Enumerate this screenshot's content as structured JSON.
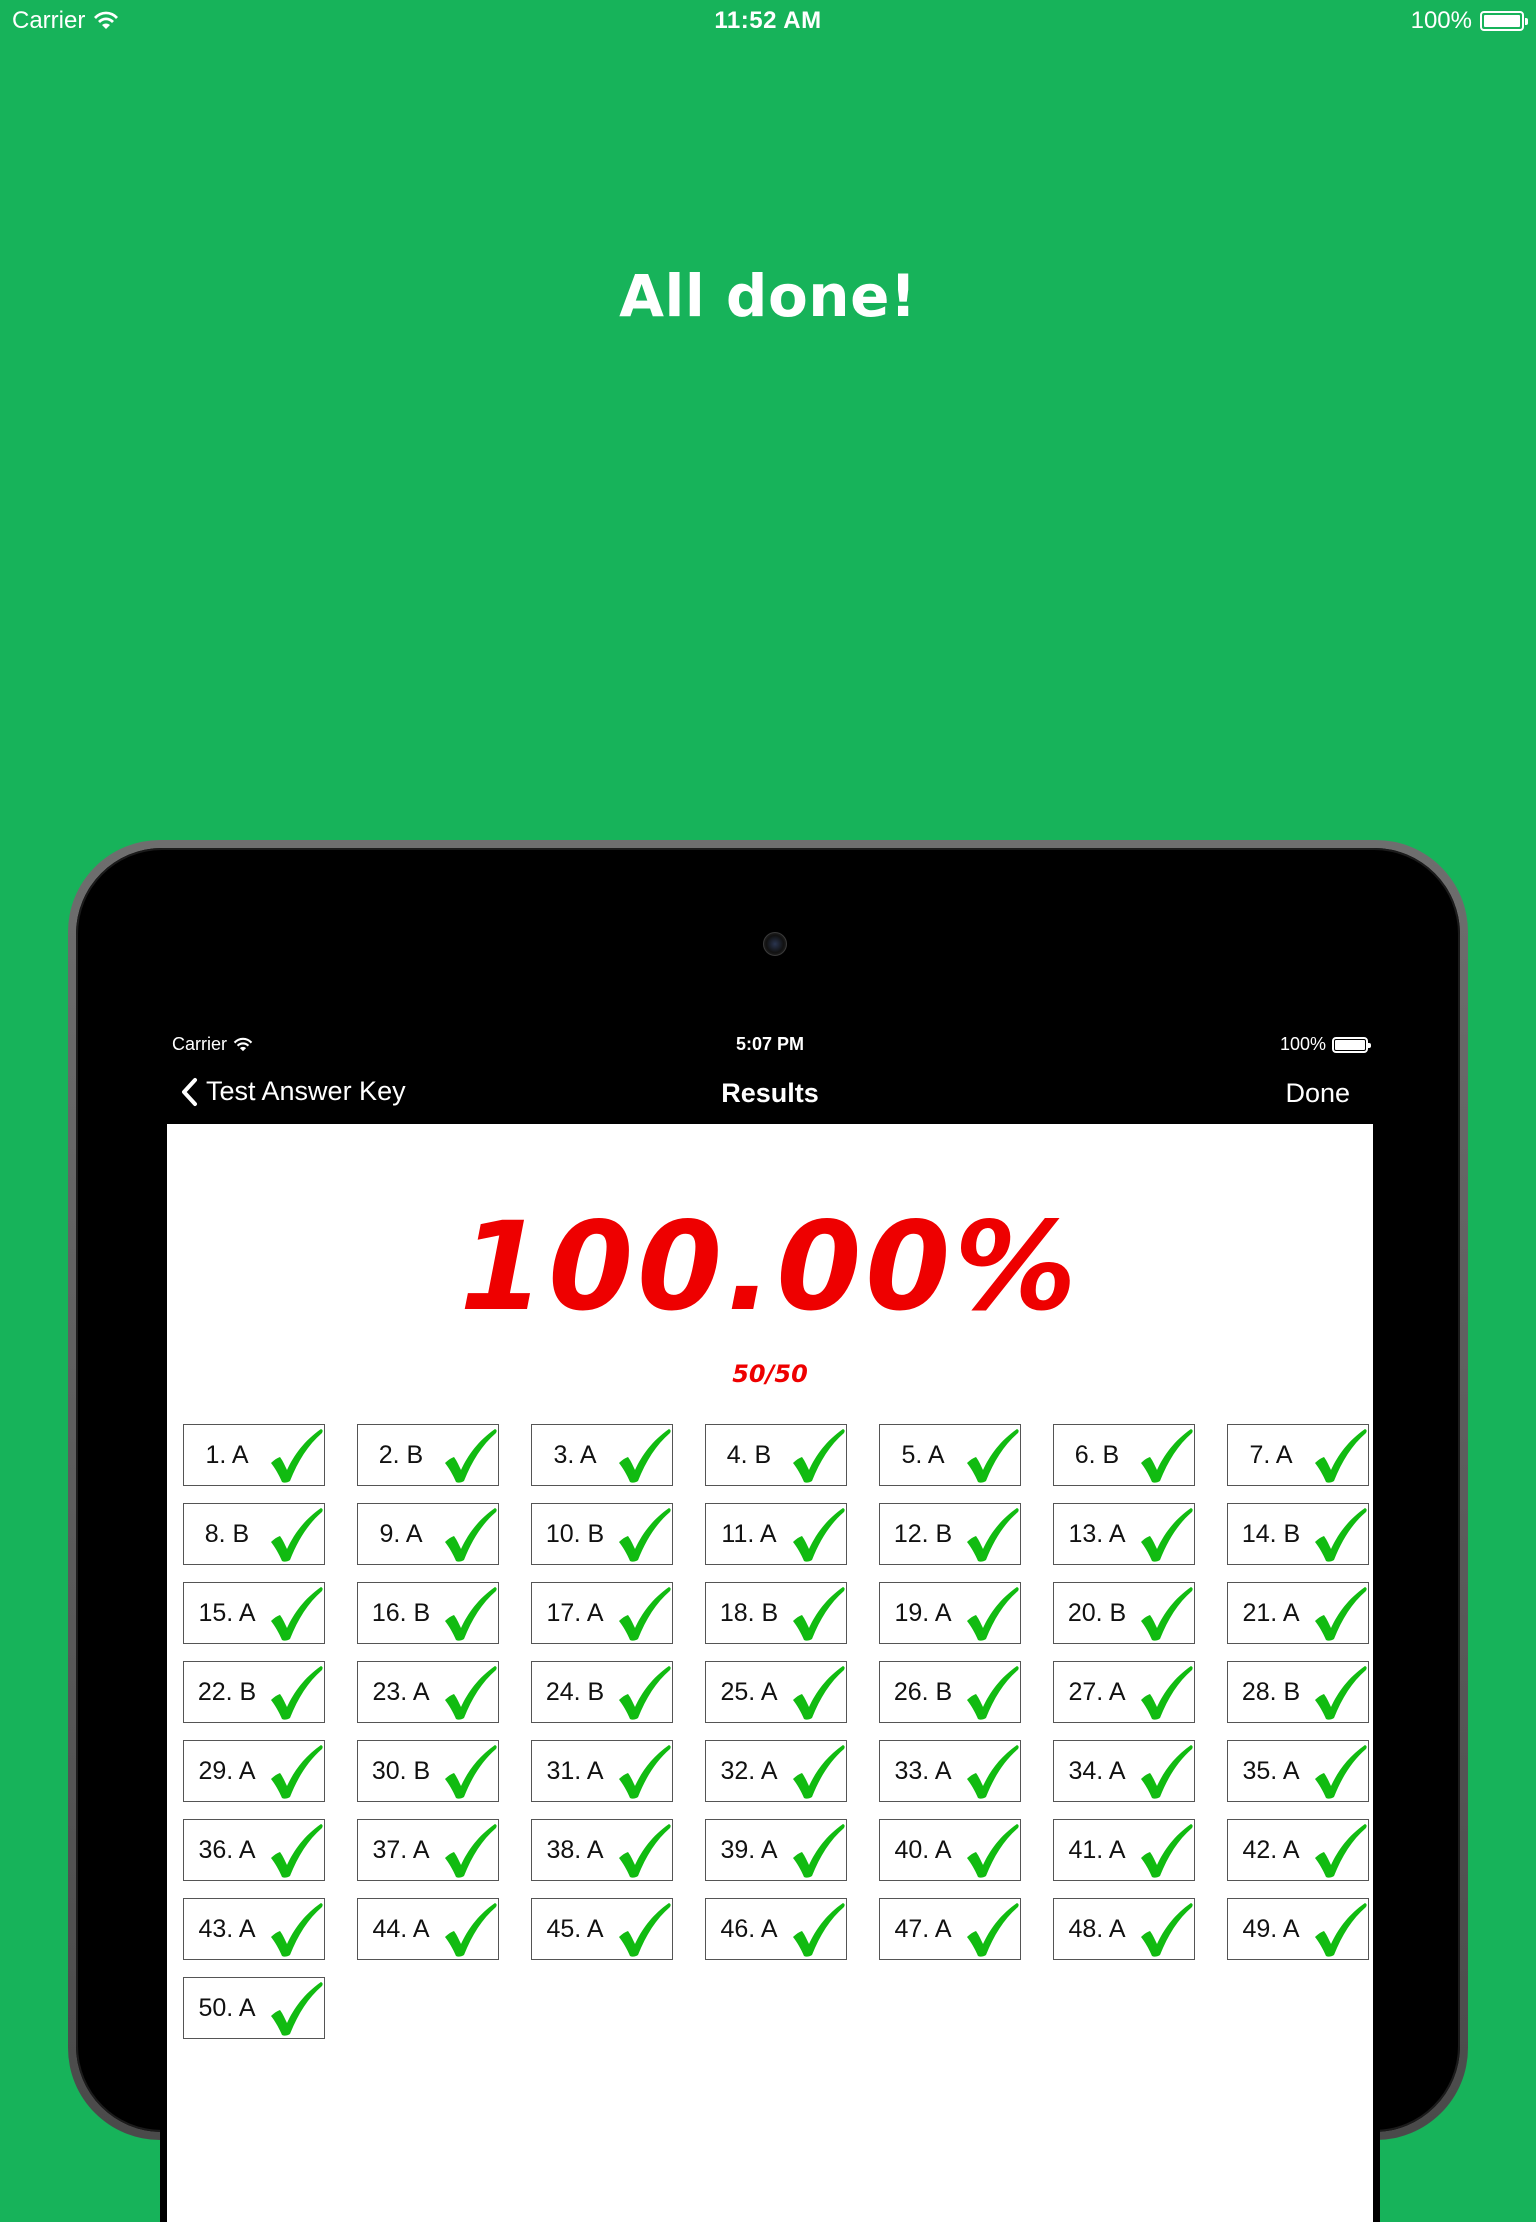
{
  "outer_status": {
    "carrier": "Carrier",
    "time": "11:52 AM",
    "battery": "100%"
  },
  "headline": "All done!",
  "screen": {
    "status": {
      "carrier": "Carrier",
      "time": "5:07 PM",
      "battery": "100%"
    },
    "nav": {
      "back_label": "Test Answer Key",
      "title": "Results",
      "done_label": "Done"
    },
    "score_percent": "100.00%",
    "score_fraction": "50/50",
    "answers": [
      "1. A",
      "2. B",
      "3. A",
      "4. B",
      "5. A",
      "6. B",
      "7. A",
      "8. B",
      "9. A",
      "10. B",
      "11. A",
      "12. B",
      "13. A",
      "14. B",
      "15. A",
      "16. B",
      "17. A",
      "18. B",
      "19. A",
      "20. B",
      "21. A",
      "22. B",
      "23. A",
      "24. B",
      "25. A",
      "26. B",
      "27. A",
      "28. B",
      "29. A",
      "30. B",
      "31. A",
      "32. A",
      "33. A",
      "34. A",
      "35. A",
      "36. A",
      "37. A",
      "38. A",
      "39. A",
      "40. A",
      "41. A",
      "42. A",
      "43. A",
      "44. A",
      "45. A",
      "46. A",
      "47. A",
      "48. A",
      "49. A",
      "50. A"
    ]
  },
  "colors": {
    "background": "#17b35a",
    "score": "#ee0000",
    "check": "#11bb11"
  },
  "icons": {
    "wifi": "wifi-icon",
    "battery": "battery-icon",
    "back": "chevron-left-icon",
    "correct": "checkmark-icon",
    "camera": "camera-icon"
  }
}
